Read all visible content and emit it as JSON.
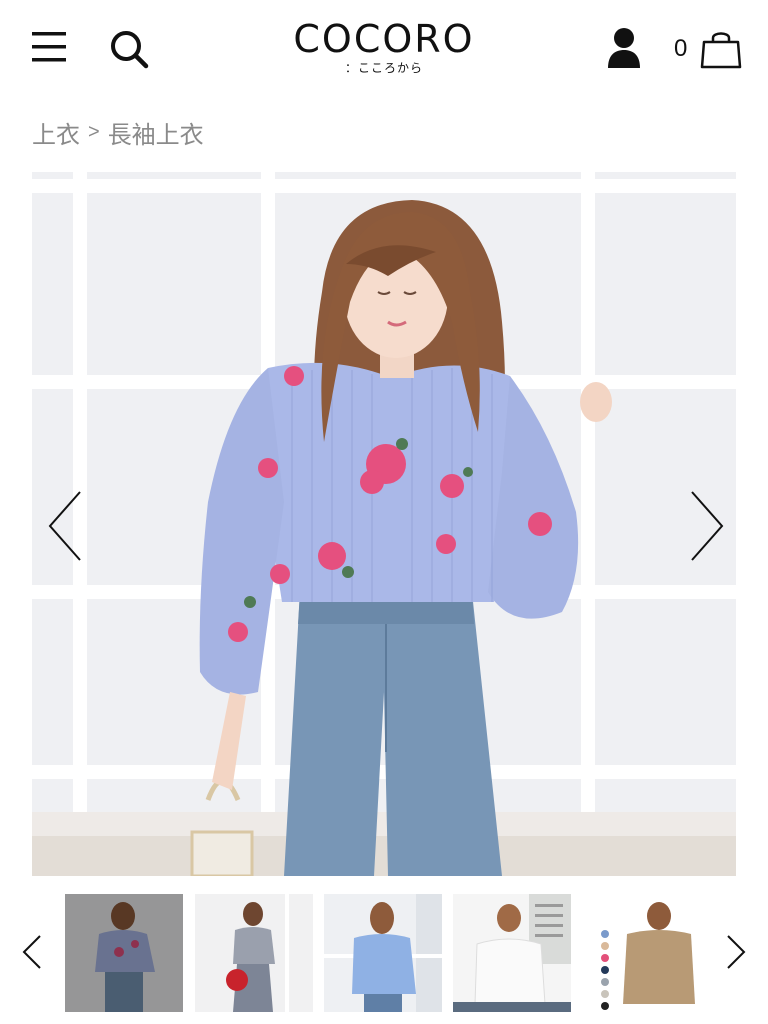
{
  "header": {
    "logo": "COCORO",
    "logo_sub": "：こころから",
    "menu_icon": "hamburger-menu-icon",
    "search_icon": "search-icon",
    "account_icon": "user-icon",
    "cart_icon": "shopping-bag-icon",
    "cart_count": "0"
  },
  "breadcrumb": {
    "items": [
      "上衣",
      "長袖上衣"
    ],
    "separator": ">"
  },
  "gallery": {
    "prev_icon": "chevron-left-icon",
    "next_icon": "chevron-right-icon",
    "thumbnails": [
      {
        "id": "thumb-1",
        "selected": true
      },
      {
        "id": "thumb-2",
        "selected": false
      },
      {
        "id": "thumb-3",
        "selected": false
      },
      {
        "id": "thumb-4",
        "selected": false
      },
      {
        "id": "thumb-5",
        "selected": false
      }
    ]
  },
  "colors": {
    "text": "#111111",
    "breadcrumb": "#8a8a8a",
    "shirt_blue": "#a9b8e6",
    "denim": "#6f8fb0",
    "flower_pink": "#e5507f"
  }
}
